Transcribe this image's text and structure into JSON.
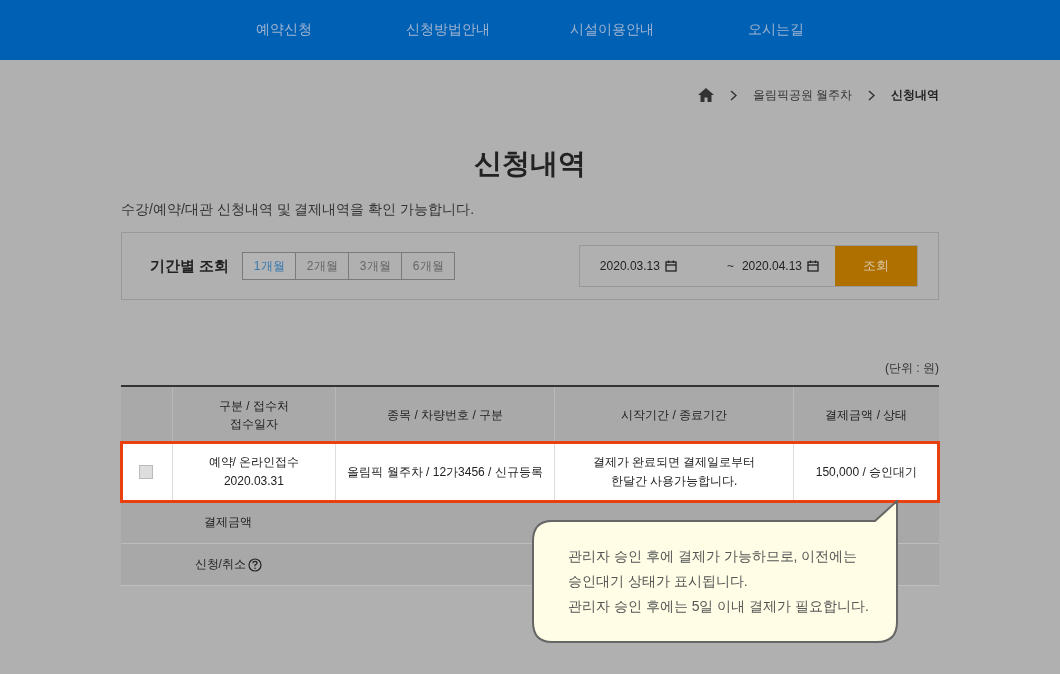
{
  "nav": {
    "items": [
      "예약신청",
      "신청방법안내",
      "시설이용안내",
      "오시는길"
    ]
  },
  "breadcrumb": [
    "올림픽공원 월주차",
    "신청내역"
  ],
  "title": "신청내역",
  "description": "수강/예약/대관 신청내역 및 결제내역을 확인 가능합니다.",
  "filter": {
    "label": "기간별 조회",
    "periods": [
      {
        "label": "1개월",
        "selected": true
      },
      {
        "label": "2개월",
        "selected": false
      },
      {
        "label": "3개월",
        "selected": false
      },
      {
        "label": "6개월",
        "selected": false
      }
    ],
    "date_from": "2020.03.13",
    "separator": "~",
    "date_to": "2020.04.13",
    "search_button": "조회"
  },
  "unit": "(단위 : 원)",
  "table": {
    "columns": [
      {
        "lines": [
          "구분 / 접수처",
          "접수일자"
        ]
      },
      {
        "lines": [
          "종목 / 차량번호 / 구분"
        ]
      },
      {
        "lines": [
          "시작기간 / 종료기간"
        ]
      },
      {
        "lines": [
          "결제금액 / 상태"
        ]
      }
    ],
    "rows": [
      {
        "checked": false,
        "highlighted": true,
        "cells": [
          {
            "lines": [
              "예약/ 온라인접수",
              "2020.03.31"
            ]
          },
          {
            "lines": [
              "올림픽 월주차 / 12가3456 / 신규등록"
            ]
          },
          {
            "lines": [
              "결제가 완료되면 결제일로부터",
              "한달간 사용가능합니다."
            ]
          },
          {
            "lines": [
              "150,000 / 승인대기"
            ]
          }
        ]
      }
    ],
    "summary": [
      {
        "label": "결제금액",
        "help": false
      },
      {
        "label": "신청/취소",
        "help": true
      }
    ]
  },
  "tooltip": [
    "관리자 승인 후에 결제가 가능하므로, 이전에는",
    "승인대기 상태가 표시됩니다.",
    "관리자 승인 후에는 5일 이내 결제가 필요합니다."
  ]
}
